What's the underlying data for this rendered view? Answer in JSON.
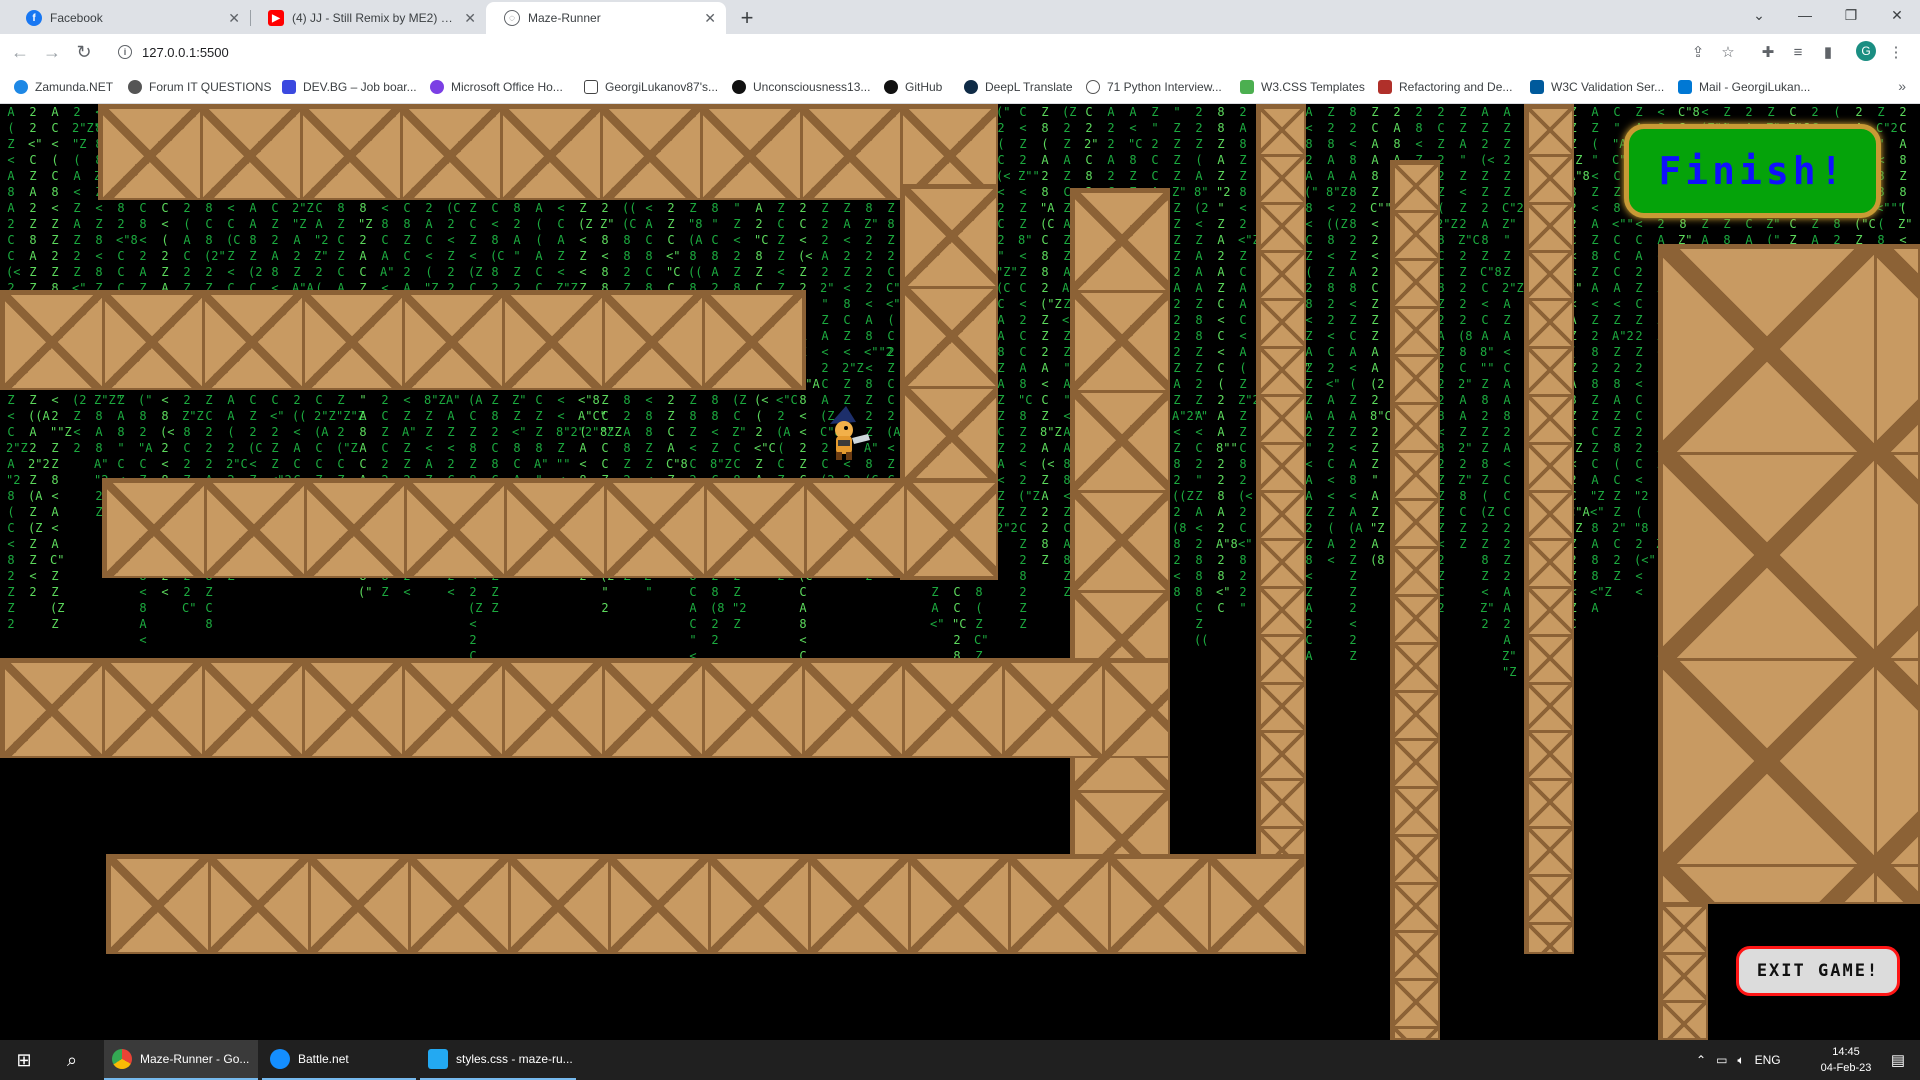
{
  "browser": {
    "tabs": [
      {
        "label": "Facebook",
        "icon": "facebook-icon"
      },
      {
        "label": "(4) JJ - Still Remix by ME2) Origin",
        "icon": "youtube-icon"
      },
      {
        "label": "Maze-Runner",
        "icon": "globe-icon"
      }
    ],
    "url": "127.0.0.1:5500",
    "profile_initial": "G",
    "bookmarks": [
      "Zamunda.NET",
      "Forum IT QUESTIONS",
      "DEV.BG – Job boar...",
      "Microsoft Office Ho...",
      "GeorgiLukanov87's...",
      "Unconsciousness13...",
      "GitHub",
      "DeepL Translate",
      "71 Python Interview...",
      "W3.CSS Templates",
      "Refactoring and De...",
      "W3C Validation Ser...",
      "Mail - GeorgiLukan..."
    ]
  },
  "game": {
    "finish_label": "Finish!",
    "exit_label": "EXIT GAME!",
    "rain_glyphs": "2ZAC8<\"Z2(ZA<8Z\"2C",
    "colors": {
      "rain": "#21c84a",
      "finish_bg": "#05a30a",
      "finish_text": "#1010ff",
      "exit_border": "#ff1616",
      "crate": "#c89a62"
    }
  },
  "taskbar": {
    "apps": [
      "Maze-Runner - Go...",
      "Battle.net",
      "styles.css - maze-ru..."
    ],
    "language": "ENG",
    "time": "14:45",
    "date": "04-Feb-23"
  }
}
